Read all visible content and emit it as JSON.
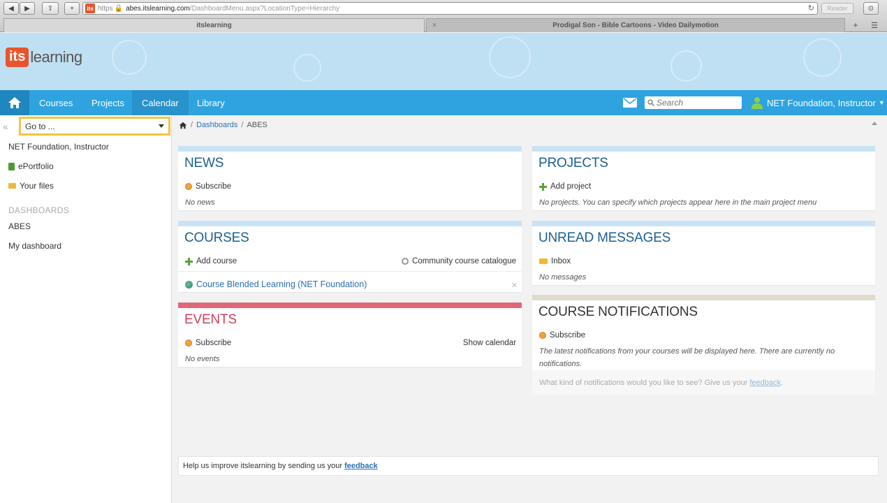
{
  "browser": {
    "url_scheme": "https",
    "url_host": "abes.itslearning.com",
    "url_path": "/DashboardMenu.aspx?LocationType=Hierarchy",
    "reader_label": "Reader",
    "favicon_text": "its",
    "tabs": [
      {
        "title": "itslearning",
        "active": true
      },
      {
        "title": "Prodigal Son - Bible Cartoons - Video Dailymotion",
        "active": false
      }
    ]
  },
  "logo": {
    "its": "its",
    "learning": "learning",
    "brand_color": "#e8552d"
  },
  "nav": {
    "items": [
      "Courses",
      "Projects",
      "Calendar",
      "Library"
    ],
    "search_placeholder": "Search",
    "user_label": "NET Foundation, Instructor",
    "bar_color": "#2ea3e0"
  },
  "sidebar": {
    "goto_label": "Go to ...",
    "user_name": "NET Foundation, Instructor",
    "links": [
      "ePortfolio",
      "Your files"
    ],
    "dashboards_heading": "DASHBOARDS",
    "dashboards": [
      "ABES",
      "My dashboard"
    ]
  },
  "breadcrumb": {
    "dashboards": "Dashboards",
    "current": "ABES"
  },
  "news": {
    "title": "NEWS",
    "subscribe": "Subscribe",
    "empty": "No news"
  },
  "courses": {
    "title": "COURSES",
    "add": "Add course",
    "catalogue": "Community course catalogue",
    "items": [
      "Course Blended Learning (NET Foundation)"
    ]
  },
  "events": {
    "title": "EVENTS",
    "subscribe": "Subscribe",
    "show_calendar": "Show calendar",
    "empty": "No events"
  },
  "projects": {
    "title": "PROJECTS",
    "add": "Add project",
    "empty": "No projects. You can specify which projects appear here in the main project menu"
  },
  "messages": {
    "title": "UNREAD MESSAGES",
    "inbox": "Inbox",
    "empty": "No messages"
  },
  "notifications": {
    "title": "COURSE NOTIFICATIONS",
    "subscribe": "Subscribe",
    "note": "The latest notifications from your courses will be displayed here. There are currently no notifications.",
    "footer_text": "What kind of notifications would you like to see? Give us your",
    "footer_link": "feedback",
    "footer_end": "."
  },
  "feedback_bar": {
    "text": "Help us improve itslearning by sending us your",
    "link": "feedback"
  },
  "colors": {
    "accent": "#2ea3e0",
    "events": "#e06878",
    "card_header": "#c9e3f5",
    "goto_border": "#f6c343"
  }
}
